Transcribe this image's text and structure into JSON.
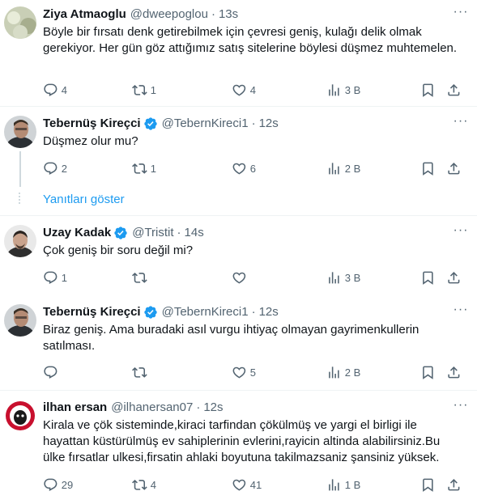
{
  "tweets": [
    {
      "name": "Ziya Atmaoglu",
      "verified": false,
      "handle": "@dweepoglou",
      "dot": "·",
      "time": "13s",
      "text": "Böyle bir fırsatı denk getirebilmek için çevresi geniş, kulağı delik olmak gerekiyor. Her gün göz attığımız satış sitelerine böylesi düşmez muhtemelen.",
      "replies": "4",
      "retweets": "1",
      "likes": "4",
      "views": "3 B"
    },
    {
      "name": "Tebernüş Kireçci",
      "verified": true,
      "handle": "@TebernKireci1",
      "dot": "·",
      "time": "12s",
      "text": "Düşmez olur mu?",
      "replies": "2",
      "retweets": "1",
      "likes": "6",
      "views": "2 B"
    },
    {
      "name": "Uzay Kadak",
      "verified": true,
      "handle": "@Tristit",
      "dot": "·",
      "time": "14s",
      "text": "Çok geniş bir soru değil mi?",
      "replies": "1",
      "retweets": "",
      "likes": "",
      "views": "3 B"
    },
    {
      "name": "Tebernüş Kireçci",
      "verified": true,
      "handle": "@TebernKireci1",
      "dot": "·",
      "time": "12s",
      "text": "Biraz geniş. Ama buradaki asıl vurgu ihtiyaç olmayan gayrimenkullerin satılması.",
      "replies": "",
      "retweets": "",
      "likes": "5",
      "views": "2 B"
    },
    {
      "name": "ilhan ersan",
      "verified": false,
      "handle": "@ilhanersan07",
      "dot": "·",
      "time": "12s",
      "text": "Kirala ve çök sisteminde,kiraci tarfindan çökülmüş ve yargi el birligi ile hayattan küstürülmüş ev sahiplerinin evlerini,rayicin altinda alabilirsiniz.Bu ülke fırsatlar ulkesi,firsatin ahlaki boyutuna takilmazsaniz şansiniz yüksek.",
      "replies": "29",
      "retweets": "4",
      "likes": "41",
      "views": "1 B"
    }
  ],
  "show_replies": "Yanıtları göster",
  "more_icon": "···",
  "colors": {
    "accent": "#1d9bf0",
    "muted": "#536471",
    "text": "#0f1419"
  }
}
